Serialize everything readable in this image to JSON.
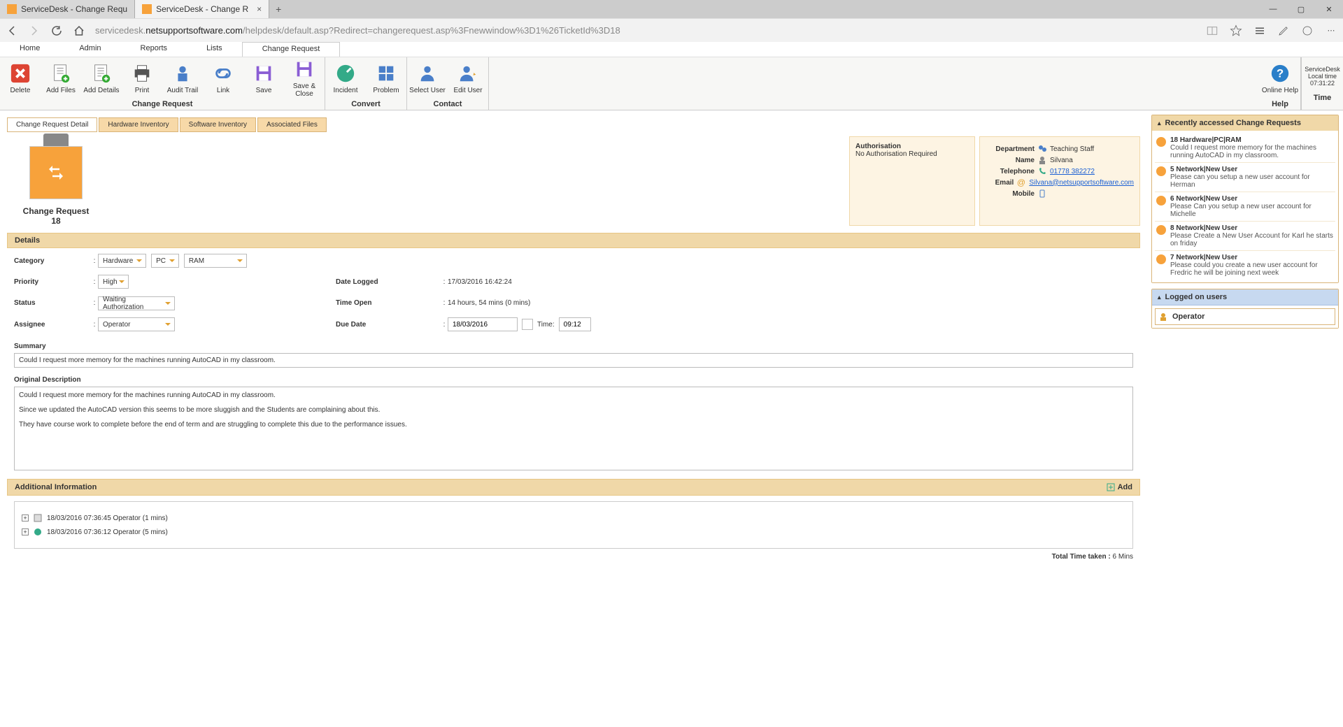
{
  "browser": {
    "tabs": [
      {
        "title": "ServiceDesk - Change Requ",
        "active": false
      },
      {
        "title": "ServiceDesk - Change R",
        "active": true
      }
    ],
    "url_prefix": "servicedesk.",
    "url_host": "netsupportsoftware.com",
    "url_path": "/helpdesk/default.asp?Redirect=changerequest.asp%3Fnewwindow%3D1%26TicketId%3D18"
  },
  "app_menu": [
    "Home",
    "Admin",
    "Reports",
    "Lists",
    "Change Request"
  ],
  "ribbon": {
    "groups": [
      {
        "label": "Change Request",
        "items": [
          {
            "name": "delete",
            "label": "Delete"
          },
          {
            "name": "add-files",
            "label": "Add Files"
          },
          {
            "name": "add-details",
            "label": "Add Details"
          },
          {
            "name": "print",
            "label": "Print"
          },
          {
            "name": "audit-trail",
            "label": "Audit Trail"
          },
          {
            "name": "link",
            "label": "Link"
          },
          {
            "name": "save",
            "label": "Save"
          },
          {
            "name": "save-close",
            "label": "Save & Close"
          }
        ]
      },
      {
        "label": "Convert",
        "items": [
          {
            "name": "incident",
            "label": "Incident"
          },
          {
            "name": "problem",
            "label": "Problem"
          }
        ]
      },
      {
        "label": "Contact",
        "items": [
          {
            "name": "select-user",
            "label": "Select User"
          },
          {
            "name": "edit-user",
            "label": "Edit User"
          }
        ]
      },
      {
        "label": "Help",
        "items": [
          {
            "name": "online-help",
            "label": "Online Help"
          }
        ]
      }
    ],
    "time": {
      "l1": "ServiceDesk",
      "l2": "Local time",
      "l3": "07:31:22",
      "label": "Time"
    }
  },
  "subtabs": [
    "Change Request Detail",
    "Hardware Inventory",
    "Software Inventory",
    "Associated Files"
  ],
  "cr": {
    "title": "Change Request",
    "number": "18"
  },
  "auth": {
    "title": "Authorisation",
    "text": "No Authorisation Required"
  },
  "contact": {
    "rows": [
      {
        "label": "Department",
        "value": "Teaching Staff",
        "link": false
      },
      {
        "label": "Name",
        "value": "Silvana",
        "link": false
      },
      {
        "label": "Telephone",
        "value": "01778 382272",
        "link": true
      },
      {
        "label": "Email",
        "value": "Silvana@netsupportsoftware.com",
        "link": true
      },
      {
        "label": "Mobile",
        "value": "",
        "link": false
      }
    ]
  },
  "sections": {
    "details": "Details",
    "addl": "Additional Information",
    "add_btn": "Add"
  },
  "form": {
    "labels": {
      "category": "Category",
      "priority": "Priority",
      "status": "Status",
      "assignee": "Assignee",
      "date_logged": "Date Logged",
      "time_open": "Time Open",
      "due_date": "Due Date",
      "summary": "Summary",
      "orig_desc": "Original Description",
      "time_lbl": "Time:"
    },
    "category": [
      "Hardware",
      "PC",
      "RAM"
    ],
    "priority": "High",
    "status": "Waiting Authorization",
    "assignee": "Operator",
    "date_logged": "17/03/2016 16:42:24",
    "time_open": "14 hours, 54 mins  (0 mins)",
    "due_date": "18/03/2016",
    "due_time": "09:12",
    "summary": "Could I request more memory for the machines running AutoCAD in my classroom.",
    "desc": [
      "Could I request more memory for the machines running AutoCAD in my classroom.",
      "Since we updated the AutoCAD version this seems to be more sluggish and the Students are complaining about this.",
      "They have course work to complete before the end of term and are struggling to complete this due to the performance issues."
    ]
  },
  "addl": {
    "items": [
      "18/03/2016 07:36:45 Operator (1 mins)",
      "18/03/2016 07:36:12 Operator (5 mins)"
    ],
    "total_label": "Total Time taken :",
    "total_value": "6 Mins"
  },
  "side": {
    "recent_hd": "Recently accessed Change Requests",
    "recent": [
      {
        "t": "18 Hardware|PC|RAM",
        "d": "Could I request more memory for the machines running AutoCAD in my classroom."
      },
      {
        "t": "5 Network|New User",
        "d": "Please can you setup a new user account for Herman"
      },
      {
        "t": "6 Network|New User",
        "d": "Please Can you setup a new user account for Michelle"
      },
      {
        "t": "8 Network|New User",
        "d": "Please Create a New User Account for Karl he starts on friday"
      },
      {
        "t": "7 Network|New User",
        "d": "Please could you create a new user account for Fredric he will be joining next week"
      }
    ],
    "logged_hd": "Logged on users",
    "logged_user": "Operator"
  }
}
